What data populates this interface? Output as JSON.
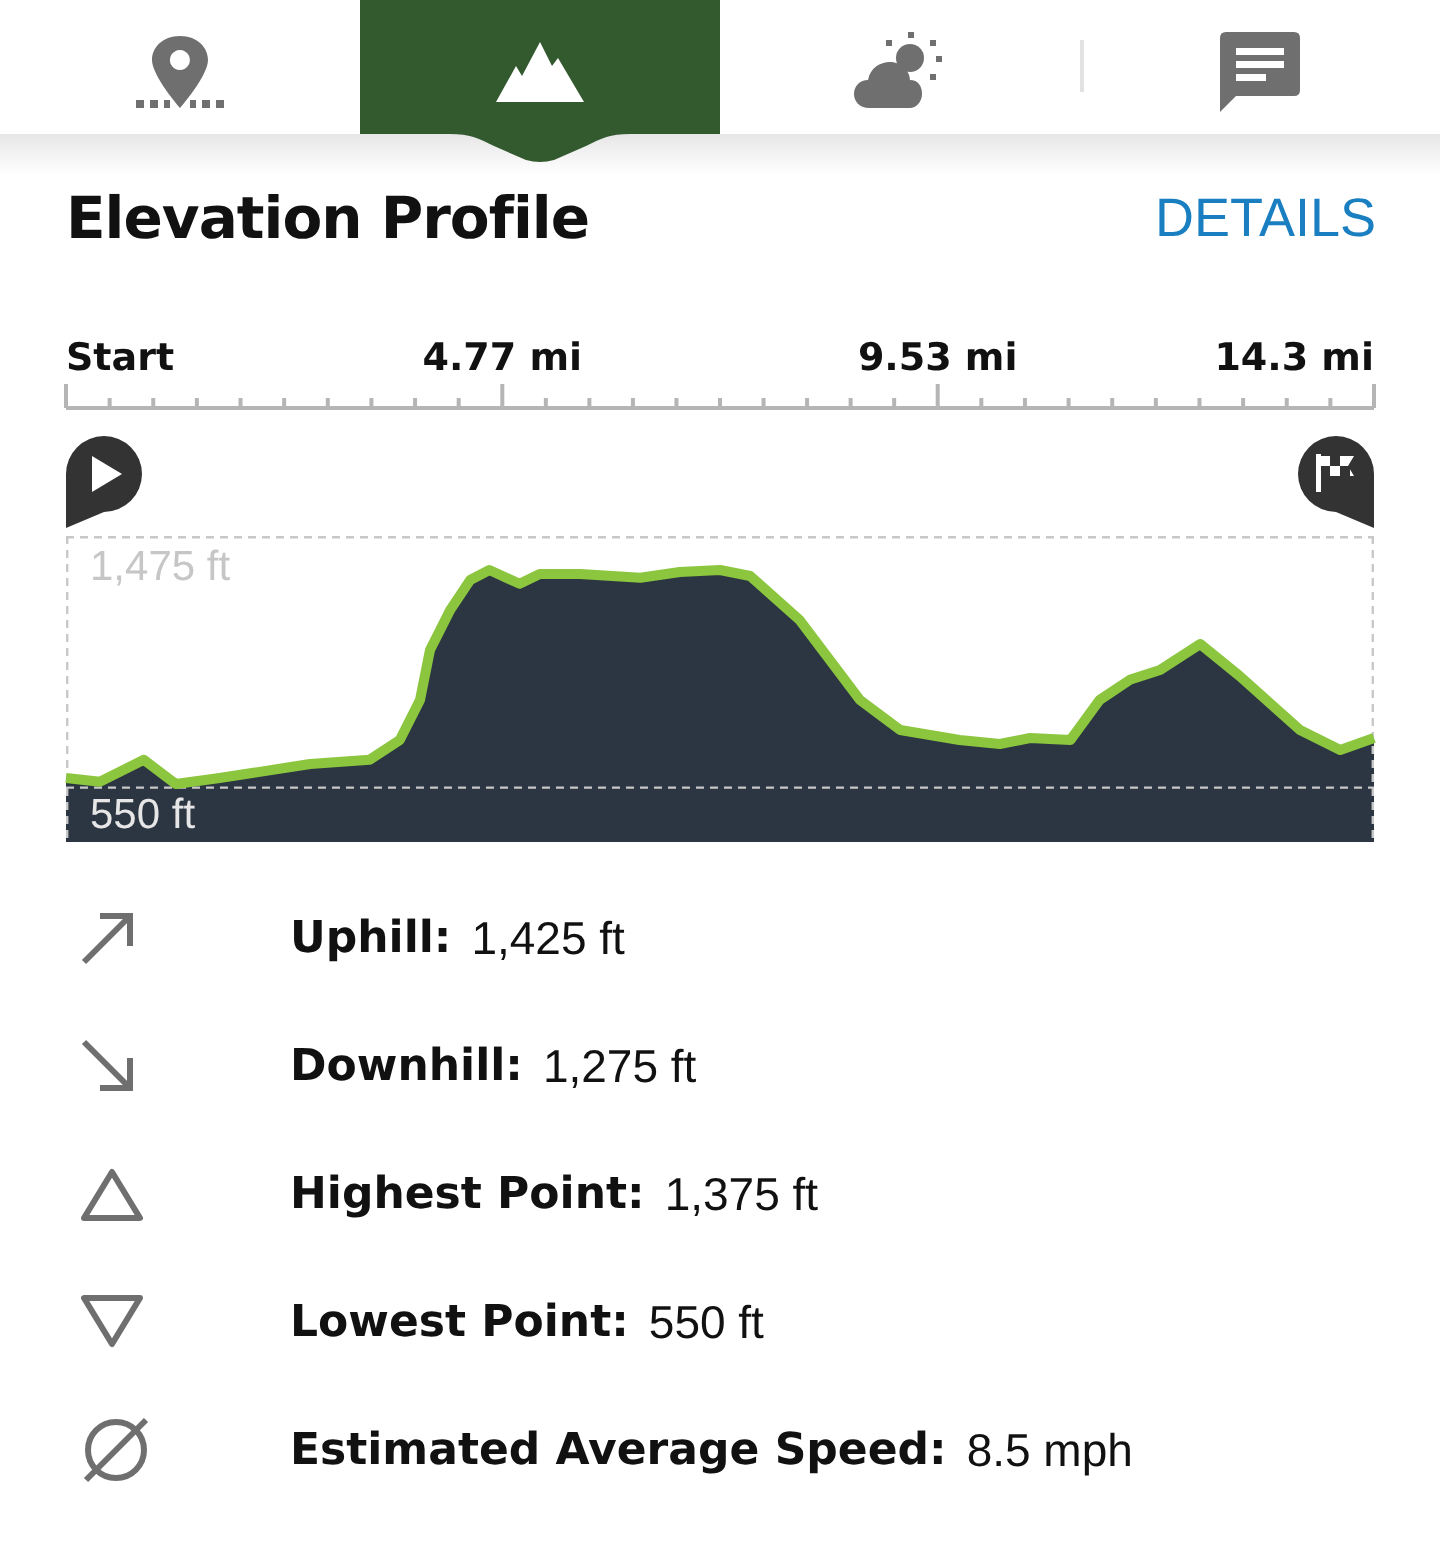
{
  "tabs": [
    {
      "kind": "location",
      "selected": false
    },
    {
      "kind": "elevation",
      "selected": true
    },
    {
      "kind": "weather",
      "selected": false
    },
    {
      "kind": "comments",
      "selected": false
    }
  ],
  "header": {
    "title": "Elevation Profile",
    "link": "DETAILS"
  },
  "profile": {
    "chart_data": {
      "type": "area",
      "xlim": [
        0,
        14.3
      ],
      "ylim": [
        350,
        1475
      ],
      "xticks": [
        {
          "value": 0,
          "label": "Start"
        },
        {
          "value": 4.77,
          "label": "4.77 mi"
        },
        {
          "value": 9.53,
          "label": "9.53 mi"
        },
        {
          "value": 14.3,
          "label": "14.3 mi"
        }
      ],
      "yticks": [
        {
          "value": 1475,
          "label": "1,475 ft"
        },
        {
          "value": 550,
          "label": "550 ft"
        }
      ],
      "x": [
        0,
        0.37,
        0.85,
        1.2,
        1.68,
        2.67,
        3.32,
        3.65,
        3.87,
        3.98,
        4.2,
        4.42,
        4.63,
        4.96,
        5.18,
        5.62,
        6.28,
        6.71,
        7.15,
        7.48,
        8.02,
        8.35,
        8.68,
        9.12,
        9.77,
        10.21,
        10.54,
        10.98,
        11.3,
        11.63,
        11.96,
        12.4,
        12.83,
        13.49,
        13.93,
        14.3
      ],
      "series": [
        {
          "color": "#8cc63f",
          "values": [
            585,
            571,
            652,
            563,
            585,
            637,
            652,
            725,
            872,
            1056,
            1203,
            1313,
            1350,
            1299,
            1335,
            1335,
            1321,
            1343,
            1350,
            1328,
            1166,
            1019,
            872,
            762,
            725,
            710,
            732,
            725,
            872,
            946,
            982,
            1078,
            960,
            762,
            688,
            732
          ]
        }
      ]
    }
  },
  "stats": [
    {
      "kind": "uphill",
      "label": "Uphill:",
      "value": "1,425 ft"
    },
    {
      "kind": "downhill",
      "label": "Downhill:",
      "value": "1,275 ft"
    },
    {
      "kind": "highest",
      "label": "Highest Point:",
      "value": "1,375 ft"
    },
    {
      "kind": "lowest",
      "label": "Lowest Point:",
      "value": "550 ft"
    },
    {
      "kind": "speed",
      "label": "Estimated Average Speed:",
      "value": "8.5 mph"
    }
  ]
}
